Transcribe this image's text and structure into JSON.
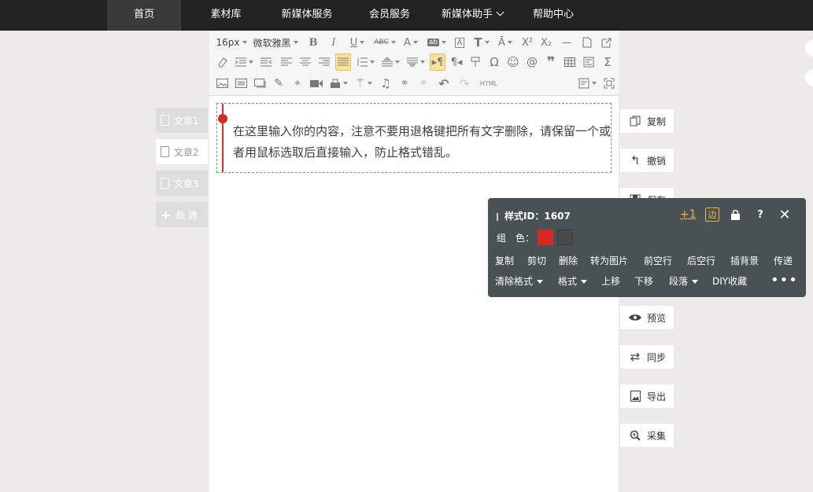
{
  "nav": {
    "items": [
      {
        "label": "首页",
        "active": true
      },
      {
        "label": "素材库"
      },
      {
        "label": "新媒体服务"
      },
      {
        "label": "会员服务"
      },
      {
        "label": "新媒体助手",
        "dropdown": true
      },
      {
        "label": "帮助中心"
      }
    ]
  },
  "toolbar": {
    "font_size": "16px",
    "font_family": "微软雅黑",
    "html_label": "HTML"
  },
  "editor": {
    "content": "在这里输入你的内容，注意不要用退格键把所有文字删除，请保留一个或者用鼠标选取后直接输入，防止格式错乱。"
  },
  "articles": [
    {
      "label": "文章1",
      "active": false
    },
    {
      "label": "文章2",
      "active": true
    },
    {
      "label": "文章3",
      "active": false
    }
  ],
  "new_article": "新 建",
  "actions": [
    {
      "label": "复制",
      "icon": "copy-icon"
    },
    {
      "label": "撤销",
      "icon": "undo-icon"
    },
    {
      "label": "保存",
      "icon": "save-icon"
    },
    {
      "label": "预览",
      "icon": "eye-icon"
    },
    {
      "label": "同步",
      "icon": "sync-icon"
    },
    {
      "label": "导出",
      "icon": "export-icon"
    },
    {
      "label": "采集",
      "icon": "collect-icon"
    }
  ],
  "popup": {
    "style_id": "样式ID：1607",
    "plus_one": "+1",
    "edge": "边",
    "help": "?",
    "group_label": "组　色：",
    "swatches": [
      "#d42a22",
      "#4a4a4a"
    ],
    "row1": [
      "复制",
      "剪切",
      "删除",
      "转为图片",
      "前空行",
      "后空行",
      "插背景",
      "传递"
    ],
    "row2": [
      {
        "label": "清除格式",
        "dropdown": true
      },
      {
        "label": "格式",
        "dropdown": true
      },
      {
        "label": "上移"
      },
      {
        "label": "下移"
      },
      {
        "label": "段落",
        "dropdown": true
      },
      {
        "label": "DIY收藏"
      }
    ],
    "more": "•••"
  },
  "colors": {
    "nav_bg": "#222222",
    "accent_red": "#d42a22",
    "popup_bg": "#485153",
    "highlight": "#f5b04b"
  }
}
